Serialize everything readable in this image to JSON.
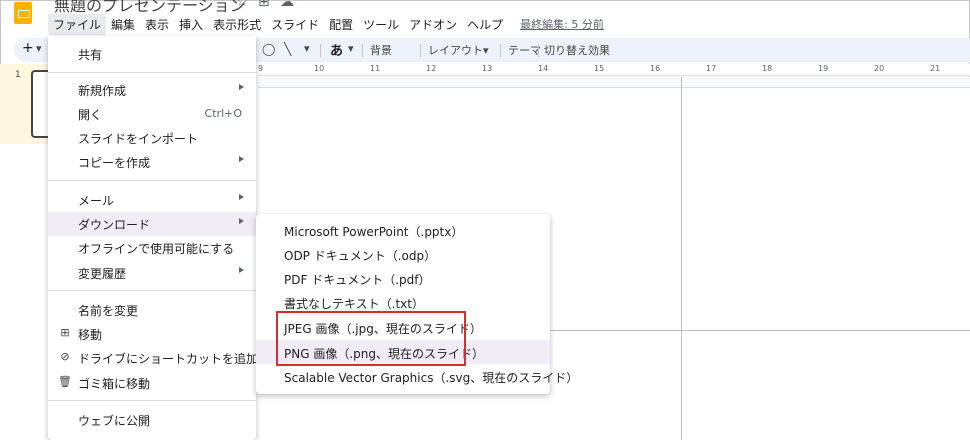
{
  "app": {
    "title": "無題のプレゼンテーション",
    "star_icon": "star-icon",
    "folder_icon": "move-folder-icon",
    "cloud_icon": "cloud-status-icon"
  },
  "menubar": {
    "items": [
      "ファイル",
      "編集",
      "表示",
      "挿入",
      "表示形式",
      "スライド",
      "配置",
      "ツール",
      "アドオン",
      "ヘルプ"
    ],
    "last_edit": "最終編集: 5 分前"
  },
  "toolbar": {
    "new_slide": "+",
    "dropdown": "▾",
    "shape_icon": "shape-icon",
    "line_icon": "line-icon",
    "text_style": "あ",
    "background": "背景",
    "layout": "レイアウト▾",
    "theme": "テーマ",
    "transition": "切り替え効果"
  },
  "filmstrip": {
    "slide_number": "1"
  },
  "ruler": {
    "ticks": [
      "9",
      "10",
      "11",
      "12",
      "13",
      "14",
      "15",
      "16",
      "17",
      "18",
      "19",
      "20",
      "21"
    ]
  },
  "file_menu": {
    "share": "共有",
    "new": "新規作成",
    "open": "開く",
    "open_shortcut": "Ctrl+O",
    "import_slides": "スライドをインポート",
    "make_copy": "コピーを作成",
    "email": "メール",
    "download": "ダウンロード",
    "offline": "オフラインで使用可能にする",
    "version_history": "変更履歴",
    "rename": "名前を変更",
    "move": "移動",
    "add_shortcut": "ドライブにショートカットを追加",
    "trash": "ゴミ箱に移動",
    "publish": "ウェブに公開"
  },
  "download_menu": {
    "pptx": "Microsoft PowerPoint（.pptx）",
    "odp": "ODP ドキュメント（.odp）",
    "pdf": "PDF ドキュメント（.pdf）",
    "txt": "書式なしテキスト（.txt）",
    "jpg": "JPEG 画像（.jpg、現在のスライド）",
    "png": "PNG 画像（.png、現在のスライド）",
    "svg": "Scalable Vector Graphics（.svg、現在のスライド）"
  },
  "colors": {
    "accent": "#f4b400",
    "highlight": "#f1ecf5",
    "callout_border": "#d32f2f"
  }
}
